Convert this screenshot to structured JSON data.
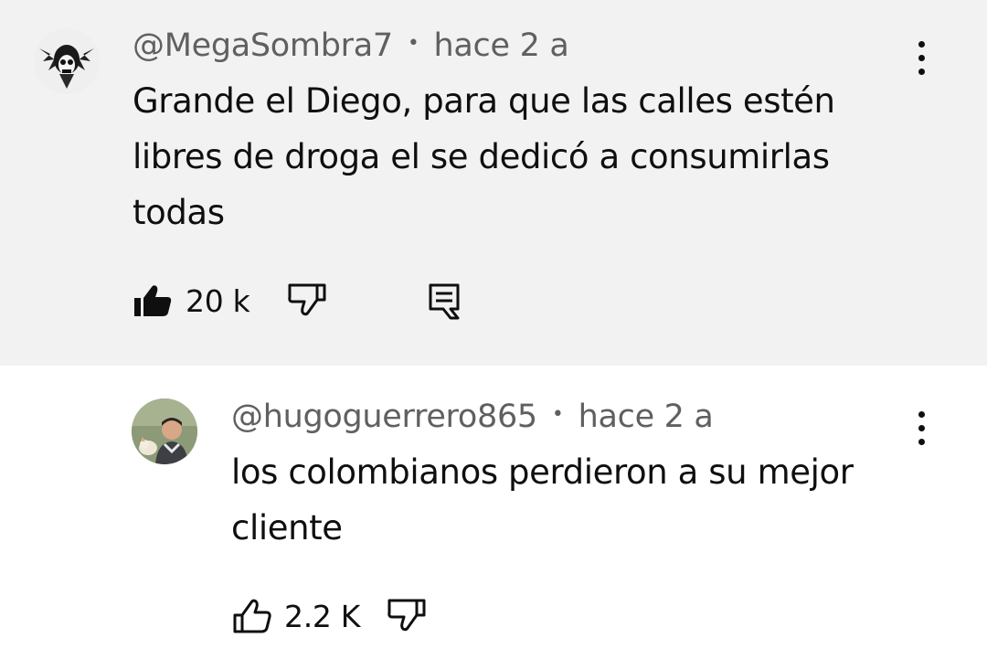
{
  "comments": [
    {
      "author": "@MegaSombra7",
      "time": "hace 2 a",
      "text": "Grande el Diego, para que las calles estén libres de droga el se dedicó a consumirlas todas",
      "likes": "20 k",
      "avatar_icon": "skull-avatar",
      "icons": [
        "thumbs-up-filled-icon",
        "thumbs-down-icon",
        "reply-icon",
        "more-vert-icon"
      ]
    },
    {
      "author": "@hugoguerrero865",
      "time": "hace 2 a",
      "text": "los colombianos perdieron a su mejor cliente",
      "likes": "2.2 K",
      "avatar_icon": "profile-photo-avatar",
      "icons": [
        "thumbs-up-icon",
        "thumbs-down-icon",
        "more-vert-icon"
      ]
    }
  ],
  "separator": "•",
  "colors": {
    "highlight_bg": "#f2f2f2",
    "meta_text": "#606060",
    "body_text": "#0f0f0f"
  }
}
